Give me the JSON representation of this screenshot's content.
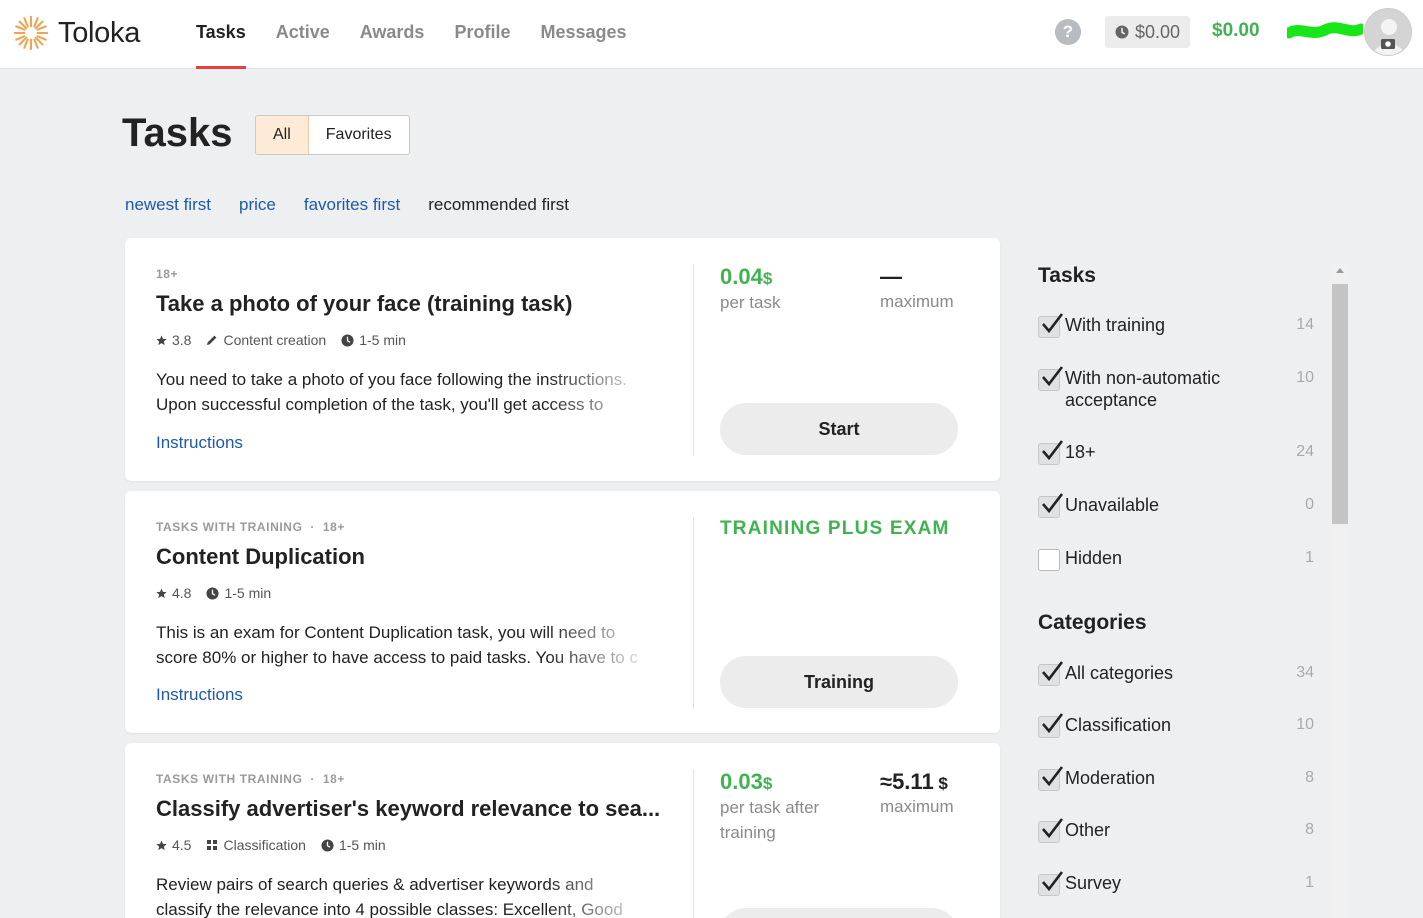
{
  "app": {
    "name": "Toloka"
  },
  "nav": [
    {
      "label": "Tasks",
      "active": true
    },
    {
      "label": "Active",
      "active": false
    },
    {
      "label": "Awards",
      "active": false
    },
    {
      "label": "Profile",
      "active": false
    },
    {
      "label": "Messages",
      "active": false
    }
  ],
  "header": {
    "help": "?",
    "pending_balance": "$0.00",
    "balance": "$0.00"
  },
  "page": {
    "title": "Tasks"
  },
  "view_toggle": {
    "all": "All",
    "favorites": "Favorites",
    "selected": "All"
  },
  "sort": {
    "options": [
      "newest first",
      "price",
      "favorites first",
      "recommended first"
    ],
    "selected": "recommended first"
  },
  "cards": [
    {
      "meta": "18+",
      "title": "Take a photo of your face (training task)",
      "rating": "3.8",
      "category": "Content creation",
      "time": "1-5 min",
      "desc_line1": "You need to take a photo of you face following the instructions.",
      "desc_line2": "Upon successful completion of the task, you'll get access to",
      "instructions": "Instructions",
      "price": "0.04",
      "currency": "$",
      "price_label": "per task",
      "max_value": "—",
      "max_label": "maximum",
      "button": "Start"
    },
    {
      "meta_type": "TASKS WITH TRAINING",
      "meta_age": "18+",
      "title": "Content Duplication",
      "rating": "4.8",
      "time": "1-5 min",
      "desc_line1": "This is an exam for Content Duplication task, you will need to",
      "desc_line2": "score 80% or higher to have access to paid tasks. You have to c",
      "instructions": "Instructions",
      "exam_label": "TRAINING PLUS EXAM",
      "button": "Training"
    },
    {
      "meta_type": "TASKS WITH TRAINING",
      "meta_age": "18+",
      "title": "Classify advertiser's keyword relevance to sea...",
      "rating": "4.5",
      "category": "Classification",
      "time": "1-5 min",
      "desc_line1": "Review pairs of search queries & advertiser keywords and",
      "desc_line2": "classify the relevance into 4 possible classes: Excellent, Good",
      "price": "0.03",
      "currency": "$",
      "price_label_1": "per task after",
      "price_label_2": "training",
      "max_value": "≈5.11",
      "max_label": "maximum"
    }
  ],
  "filters": {
    "tasks_heading": "Tasks",
    "tasks": [
      {
        "label": "With training",
        "count": "14",
        "checked": true
      },
      {
        "label": "With non-automatic acceptance",
        "count": "10",
        "checked": true
      },
      {
        "label": "18+",
        "count": "24",
        "checked": true
      },
      {
        "label": "Unavailable",
        "count": "0",
        "checked": true
      },
      {
        "label": "Hidden",
        "count": "1",
        "checked": false
      }
    ],
    "categories_heading": "Categories",
    "categories": [
      {
        "label": "All categories",
        "count": "34",
        "checked": true
      },
      {
        "label": "Classification",
        "count": "10",
        "checked": true
      },
      {
        "label": "Moderation",
        "count": "8",
        "checked": true
      },
      {
        "label": "Other",
        "count": "8",
        "checked": true
      },
      {
        "label": "Survey",
        "count": "1",
        "checked": true
      }
    ]
  },
  "colors": {
    "accent_green": "#3fb34f",
    "nav_active": "#e8403f",
    "link": "#1d5aa8",
    "toggle_active": "#fdebd7"
  },
  "icons": [
    "toloka-sun-logo",
    "help-icon",
    "clock-icon",
    "star-icon",
    "pencil-icon",
    "grid-icon",
    "camera-icon",
    "checkmark-icon"
  ]
}
